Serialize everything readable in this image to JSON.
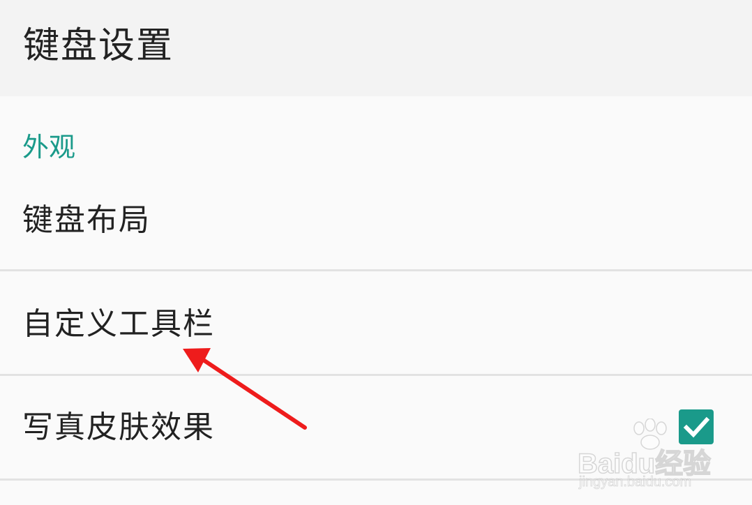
{
  "app_bar": {
    "title": "键盘设置"
  },
  "section": {
    "title": "外观"
  },
  "items": [
    {
      "label": "键盘布局"
    },
    {
      "label": "自定义工具栏"
    },
    {
      "label": "写真皮肤效果",
      "checked": true
    }
  ],
  "watermark": {
    "brand": "Baidu经验",
    "url": "jingyan.baidu.com"
  },
  "colors": {
    "accent": "#1a9a8a",
    "annotation_arrow": "#ee1c1c",
    "app_bar_bg": "#f3f3f3",
    "list_bg": "#fafafa",
    "divider": "#e2e2e2",
    "text": "#222222"
  },
  "icons": {
    "checkbox": "checkmark-icon",
    "annotation": "red-arrow-icon",
    "watermark_logo": "paw-icon"
  }
}
